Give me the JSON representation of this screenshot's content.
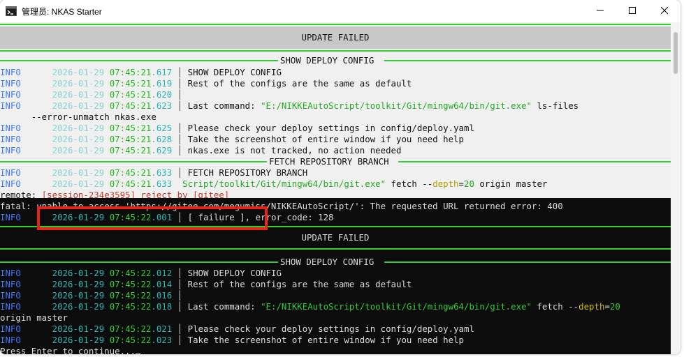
{
  "window": {
    "title": "管理员: NKAS Starter",
    "app_icon": "terminal-icon",
    "minimize_icon": "minimize-icon",
    "maximize_icon": "maximize-icon",
    "close_icon": "close-icon"
  },
  "header_update_failed": "UPDATE FAILED",
  "rule_show_deploy_config": "SHOW DEPLOY CONFIG",
  "rule_fetch_repository_branch": "FETCH REPOSITORY BRANCH",
  "log1": {
    "level": "INFO",
    "r1": {
      "date": "2026-01-29",
      "time": "07:45:21",
      "ms": ".617",
      "msg": "SHOW DEPLOY CONFIG"
    },
    "r2": {
      "date": "2026-01-29",
      "time": "07:45:21",
      "ms": ".619",
      "msg": "Rest of the configs are the same as default"
    },
    "r3": {
      "date": "2026-01-29",
      "time": "07:45:21",
      "ms": ".620"
    },
    "r4": {
      "date": "2026-01-29",
      "time": "07:45:21",
      "ms": ".623",
      "prefix": "Last command: ",
      "path": "\"E:/NIKKEAutoScript/toolkit/Git/mingw64/bin/git.exe\"",
      "rest": " ls-files"
    },
    "r4b": "--error-unmatch nkas.exe",
    "r5": {
      "date": "2026-01-29",
      "time": "07:45:21",
      "ms": ".625",
      "msg": "Please check your deploy settings in config/deploy.yaml"
    },
    "r6": {
      "date": "2026-01-29",
      "time": "07:45:21",
      "ms": ".628",
      "msg": "Take the screenshot of entire window if you need help"
    },
    "r7": {
      "date": "2026-01-29",
      "time": "07:45:21",
      "ms": ".629",
      "msg": "nkas.exe is not tracked, no action needed"
    },
    "r8": {
      "date": "2026-01-29",
      "time": "07:45:21",
      "ms": ".633",
      "msg": "FETCH REPOSITORY BRANCH"
    },
    "r9": {
      "date": "2026-01-29",
      "time": "07:45:21",
      "ms": ".633",
      "path": "Script/toolkit/Git/mingw64/bin/git.exe\"",
      "mid": " fetch --",
      "opt": "depth",
      "eq": "=",
      "num": "20",
      "rest": " origin master"
    }
  },
  "remote_line": {
    "label": "remote: ",
    "msg": "[session-234e3595] reject by [gitee]"
  },
  "fatal_line": "fatal: unable to access 'https://gitee.com/megumiss/NIKKEAutoScript/': The requested URL returned error: 400",
  "failure_row": {
    "level": "INFO",
    "date": "2026-01-29",
    "time": "07:45:22",
    "ms": ".001",
    "msg": "[ failure ], error_code: 128"
  },
  "log2": {
    "level": "INFO",
    "r1": {
      "date": "2026-01-29",
      "time": "07:45:22",
      "ms": ".012",
      "msg": "SHOW DEPLOY CONFIG"
    },
    "r2": {
      "date": "2026-01-29",
      "time": "07:45:22",
      "ms": ".014",
      "msg": "Rest of the configs are the same as default"
    },
    "r3": {
      "date": "2026-01-29",
      "time": "07:45:22",
      "ms": ".016"
    },
    "r4": {
      "date": "2026-01-29",
      "time": "07:45:22",
      "ms": ".018",
      "prefix": "Last command: ",
      "path": "\"E:/NIKKEAutoScript/toolkit/Git/mingw64/bin/git.exe\"",
      "mid": " fetch --",
      "opt": "depth",
      "eq": "=",
      "num": "20"
    },
    "r4b": "origin master",
    "r5": {
      "date": "2026-01-29",
      "time": "07:45:22",
      "ms": ".021",
      "msg": "Please check your deploy settings in config/deploy.yaml"
    },
    "r6": {
      "date": "2026-01-29",
      "time": "07:45:22",
      "ms": ".023",
      "msg": "Take the screenshot of entire window if you need help"
    }
  },
  "prompt": "Press Enter to continue...",
  "colors": {
    "rule_green": "#33cc33",
    "info_blue": "#3b78ff",
    "annotation_red": "#e8231a",
    "console_dark": "#0c0c0c",
    "console_light": "#f0f0f0"
  }
}
